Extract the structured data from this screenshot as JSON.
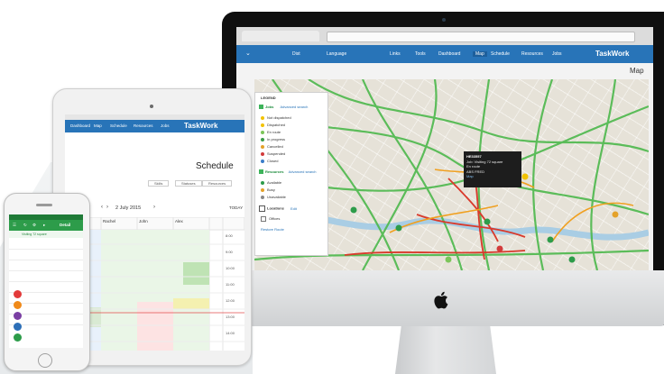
{
  "brand": {
    "name": "TaskWork",
    "accent": "#2874b8",
    "green": "#2d9c4a"
  },
  "desktop": {
    "nav_items": [
      "Jobs",
      "Resources",
      "Schedule",
      "Map",
      "Dashboard",
      "Tools",
      "Links"
    ],
    "language_label": "Language",
    "user_label": "Dist",
    "page_title": "Map",
    "legend": {
      "title": "LEGEND",
      "jobs_header": "Jobs",
      "jobs_link": "Advanced search",
      "job_statuses": [
        {
          "label": "Not dispatched",
          "color": "#f2c200"
        },
        {
          "label": "Dispatched",
          "color": "#f2c200"
        },
        {
          "label": "En route",
          "color": "#7cc55a"
        },
        {
          "label": "In progress",
          "color": "#3a9c4a"
        },
        {
          "label": "Cancelled",
          "color": "#e4a22a"
        },
        {
          "label": "Suspended",
          "color": "#d23a3a"
        },
        {
          "label": "Closed",
          "color": "#3a7dc9"
        }
      ],
      "resources_header": "Resources",
      "resources_link": "Advanced search",
      "resource_statuses": [
        {
          "label": "Available",
          "color": "#2d9c4a"
        },
        {
          "label": "Busy",
          "color": "#e4a22a"
        },
        {
          "label": "Unavailable",
          "color": "#888888"
        }
      ],
      "locations_label": "Locations",
      "locations_link": "Edit",
      "offices_label": "Offices",
      "restore_label": "Restore Route"
    },
    "tooltip_lines": [
      "HE33557",
      "Job: Visiting 72 square",
      "En route",
      "ABS FRED",
      "Map"
    ]
  },
  "tablet": {
    "page_title": "Schedule",
    "date_label": "2 July 2015",
    "today_label": "TODAY",
    "filters": [
      "Resources",
      "Statuses",
      "Skills"
    ],
    "columns": [
      "Alex",
      "John",
      "Rachel",
      "Richard"
    ],
    "times": [
      "8:00",
      "9:00",
      "10:00",
      "11:00",
      "12:00",
      "13:00",
      "14:00",
      "15:00"
    ]
  },
  "phone": {
    "title": "Detail",
    "subtitle": "Visiting 72 square",
    "fab_colors": [
      "#e23a3a",
      "#f08a1a",
      "#7a3fa3",
      "#2d6fb8",
      "#2d9c4a"
    ]
  }
}
